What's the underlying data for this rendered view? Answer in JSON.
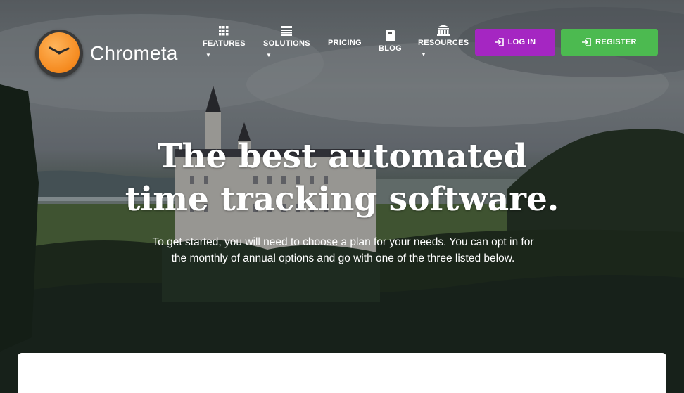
{
  "brand": {
    "name": "Chrometa"
  },
  "nav": {
    "features": "FEATURES",
    "solutions": "SOLUTIONS",
    "pricing": "PRICING",
    "blog": "BLOG",
    "resources": "RESOURCES"
  },
  "actions": {
    "login": "LOG IN",
    "register": "REGISTER"
  },
  "hero": {
    "headline_line1": "The best automated",
    "headline_line2": "time tracking software.",
    "subtitle": "To get started, you will need to choose a plan for your needs. You can opt in for the monthly of annual options and go with one of the three listed below."
  },
  "colors": {
    "login": "#a526c2",
    "register": "#4cba50",
    "logo_face": "#f58a1f"
  },
  "icons": [
    "clock-icon",
    "grid-icon",
    "list-icon",
    "book-icon",
    "bank-icon",
    "sign-in-icon"
  ]
}
